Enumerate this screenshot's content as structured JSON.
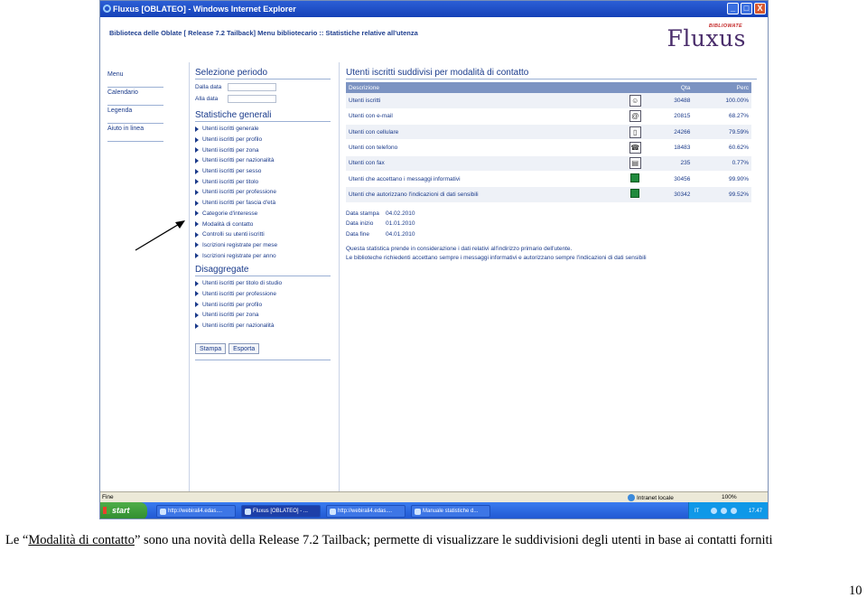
{
  "window": {
    "title": "Fluxus [OBLATEO] - Windows Internet Explorer",
    "controls": [
      "_",
      "□",
      "X"
    ]
  },
  "header": {
    "breadcrumb": "Biblioteca delle Oblate [ Release 7.2 Tailback] Menu bibliotecario :: Statistiche relative all'utenza",
    "logo_small": "BIBLIOWATE",
    "logo": "Fluxus"
  },
  "leftmenu": [
    "Menu",
    "Calendario",
    "Legenda",
    "Aiuto in linea"
  ],
  "period": {
    "title": "Selezione periodo",
    "from_label": "Dalla data",
    "to_label": "Alla data"
  },
  "general": {
    "title": "Statistiche generali",
    "items": [
      "Utenti iscritti generale",
      "Utenti iscritti per profilo",
      "Utenti iscritti per zona",
      "Utenti iscritti per nazionalità",
      "Utenti iscritti per sesso",
      "Utenti iscritti per titolo",
      "Utenti iscritti per professione",
      "Utenti iscritti per fascia d'età",
      "Categorie d'interesse",
      "Modalità di contatto",
      "Controlli su utenti iscritti",
      "Iscrizioni registrate per mese",
      "Iscrizioni registrate per anno"
    ]
  },
  "disaggregate": {
    "title": "Disaggregate",
    "items": [
      "Utenti iscritti per titolo di studio",
      "Utenti iscritti per professione",
      "Utenti iscritti per profilo",
      "Utenti iscritti per zona",
      "Utenti iscritti per nazionalità"
    ]
  },
  "buttons": {
    "print": "Stampa",
    "export": "Esporta"
  },
  "report": {
    "title": "Utenti iscritti suddivisi per modalità di contatto",
    "columns": {
      "desc": "Descrizione",
      "qty": "Qta",
      "perc": "Perc"
    },
    "rows": [
      {
        "desc": "Utenti iscritti",
        "icon": "person-icon",
        "glyph": "☺",
        "qty": "30488",
        "perc": "100.00%"
      },
      {
        "desc": "Utenti con e-mail",
        "icon": "email-icon",
        "glyph": "@",
        "qty": "20815",
        "perc": "68.27%"
      },
      {
        "desc": "Utenti con cellulare",
        "icon": "mobile-phone-icon",
        "glyph": "▯",
        "qty": "24266",
        "perc": "79.59%"
      },
      {
        "desc": "Utenti con telefono",
        "icon": "telephone-icon",
        "glyph": "☎",
        "qty": "18483",
        "perc": "60.62%"
      },
      {
        "desc": "Utenti con fax",
        "icon": "fax-icon",
        "glyph": "▤",
        "qty": "235",
        "perc": "0.77%"
      },
      {
        "desc": "Utenti che accettano i messaggi informativi",
        "icon": "green-square-icon",
        "glyph": "",
        "qty": "30456",
        "perc": "99.90%"
      },
      {
        "desc": "Utenti che autorizzano l'indicazioni di dati sensibili",
        "icon": "green-square-icon",
        "glyph": "",
        "qty": "30342",
        "perc": "99.52%"
      }
    ],
    "dates": [
      {
        "k": "Data stampa",
        "v": "04.02.2010"
      },
      {
        "k": "Data inizio",
        "v": "01.01.2010"
      },
      {
        "k": "Data fine",
        "v": "04.01.2010"
      }
    ],
    "note1": "Questa statistica prende in considerazione i dati relativi all'indirizzo primario dell'utente.",
    "note2": "Le biblioteche richiedenti accettano sempre i messaggi informativi e autorizzano sempre l'indicazioni di dati sensibili"
  },
  "statusbar": {
    "left": "Fine",
    "zone": "Intranet locale",
    "zoom": "100%"
  },
  "taskbar": {
    "start": "start",
    "tasks": [
      "http://webirali4.edas....",
      "Fluxus [OBLATEO] - ...",
      "http://webirali4.edas....",
      "Manuale statistiche d..."
    ],
    "lang": "IT",
    "clock": "17.47"
  },
  "caption": {
    "prefix": "Le",
    "link": "Modalità di contatto",
    "rest": "sono una novità della Release 7.2 Tailback; permette di visualizzare le suddivisioni degli utenti in base ai contatti forniti",
    "open_quote": "“",
    "close_quote": "”"
  },
  "page_number": "10"
}
